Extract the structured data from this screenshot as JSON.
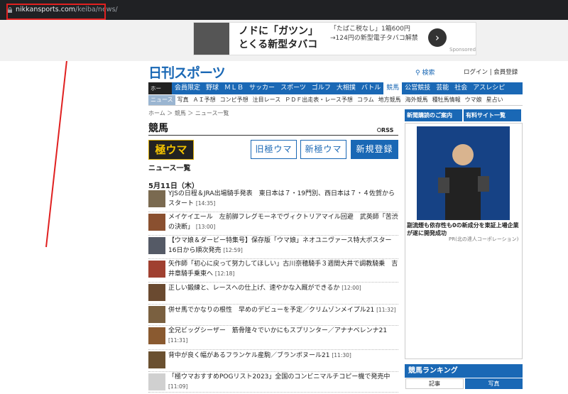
{
  "browser": {
    "url_host": "nikkansports.com",
    "url_path": "/keiba/news/"
  },
  "ad": {
    "title": "ノドに「ガツン」とくる新型タバコ",
    "sub": "「たばこ税なし」1箱600円→124円の新型電子タバコ解禁",
    "btn": "›",
    "sponsored": "Sponsored"
  },
  "header": {
    "logo": "日刊スポーツ",
    "search": "検索",
    "login": "ログイン | 会員登録"
  },
  "nav1": [
    "ホー",
    "会員限定",
    "野球",
    "ＭＬＢ",
    "サッカー",
    "スポーツ",
    "ゴルフ",
    "大相撲",
    "バトル",
    "競馬",
    "公営競技",
    "芸能",
    "社会",
    "アスレシピ"
  ],
  "nav1_active": "競馬",
  "nav2": [
    "ニュース",
    "写真",
    "ＡＩ予想",
    "コンピ予想",
    "注目レース",
    "ＰＤＦ出走表・レース予想",
    "コラム",
    "地方競馬",
    "海外競馬",
    "種牡馬情報",
    "ウマ娘",
    "星占い"
  ],
  "nav2_active": "ニュース",
  "page": {
    "breadcrumb": "ホーム ＞ 競馬 ＞ ニュース一覧",
    "title": "競馬",
    "rss": "RSS",
    "gokuuma": "極ウマ",
    "btn_old": "旧極ウマ",
    "btn_new": "新極ウマ",
    "btn_register": "新規登録",
    "list_title": "ニュース一覧",
    "date": "5月11日（木）"
  },
  "news": [
    {
      "title": "YJSの日程＆JRA出場騎手発表　東日本は７・19門別、西日本は７・４佐賀からスタート",
      "time": "[14:35]",
      "color": "#7a6a50"
    },
    {
      "title": "メイケイエール　左前脚フレグモーネでヴィクトリアマイル回避　武英師「苦渋の決断」",
      "time": "[13:00]",
      "color": "#8a5030"
    },
    {
      "title": "【ウマ娘＆ダービー特集号】保存版「ウマ娘」ネオユニヴァース特大ポスター16日から順次発売",
      "time": "[12:59]",
      "color": "#555a66"
    },
    {
      "title": "矢作師「初心に戻って努力してほしい」古川奈穂騎手３週間大井で調教騎乗　吉井章騎手乗東へ",
      "time": "[12:18]",
      "color": "#a04030"
    },
    {
      "title": "正しい鍛練と、レースへの仕上げ、速やかな入厩ができるか",
      "time": "[12:00]",
      "color": "#6a4a30"
    },
    {
      "title": "併せ馬でかなりの根性　早めのデビューを予定／クリムゾンメイプル21",
      "time": "[11:32]",
      "color": "#7a6040"
    },
    {
      "title": "全兄ビッグシーザー　筋骨隆々でいかにもスプリンター／アナナベレンナ21",
      "time": "[11:31]",
      "color": "#8a5a30"
    },
    {
      "title": "背中が良く幅があるフランケル産駒／ブランボヌール21",
      "time": "[11:30]",
      "color": "#6a5030"
    },
    {
      "title": "「極ウマおすすめPOGリスト2023」全国のコンビニマルチコピー機で発売中",
      "time": "[11:09]",
      "color": "#d0d0d0"
    }
  ],
  "side": {
    "tab1": "新聞購読のご案内",
    "tab2": "有料サイト一覧",
    "caption": "副流煙も依存性も0の新成分を東証上場企業が遂に開発成功",
    "pr": "PR(北の達人コーポレーション)",
    "ranking": "競馬ランキング",
    "rtab1": "記事",
    "rtab2": "写真"
  }
}
